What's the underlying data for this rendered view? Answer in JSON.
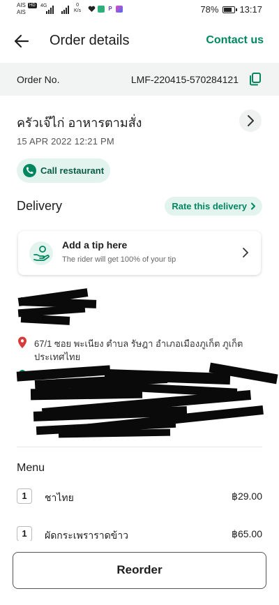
{
  "status_bar": {
    "carrier_top": "AIS",
    "carrier_bottom": "AIS",
    "hd_badge": "HD",
    "network": "4G",
    "speed_value": "0",
    "speed_unit": "K/s",
    "battery": "78%",
    "battery_level": 0.78,
    "time": "13:17"
  },
  "header": {
    "title": "Order details",
    "contact_label": "Contact us"
  },
  "order": {
    "label": "Order No.",
    "number": "LMF-220415-570284121"
  },
  "restaurant": {
    "name": "ครัวเจ๊ไก่ อาหารตามสั่ง",
    "datetime": "15 APR 2022 12:21 PM",
    "call_label": "Call restaurant"
  },
  "delivery": {
    "title": "Delivery",
    "rate_label": "Rate this delivery",
    "tip": {
      "title": "Add a tip here",
      "subtitle": "The rider will get 100% of your tip"
    },
    "address": "67/1 ซอย พะเนียง ตำบล รัษฎา อำเภอเมืองภูเก็ต ภูเก็ต ประเทศไทย"
  },
  "menu": {
    "title": "Menu",
    "items": [
      {
        "qty": "1",
        "name": "ชาไทย",
        "price": "฿29.00"
      },
      {
        "qty": "1",
        "name": "ผัดกระเพราราดข้าว",
        "price": "฿65.00"
      }
    ]
  },
  "footer": {
    "reorder_label": "Reorder"
  },
  "colors": {
    "brand_green": "#00875f",
    "light_green_bg": "#e3f4ee",
    "pin_red": "#d93a3a",
    "order_bar_bg": "#f2f3f3"
  },
  "icons": [
    "back-arrow-icon",
    "copy-icon",
    "chevron-right-icon",
    "phone-icon",
    "tip-hand-coin-icon",
    "location-pin-icon",
    "destination-dot-icon"
  ]
}
